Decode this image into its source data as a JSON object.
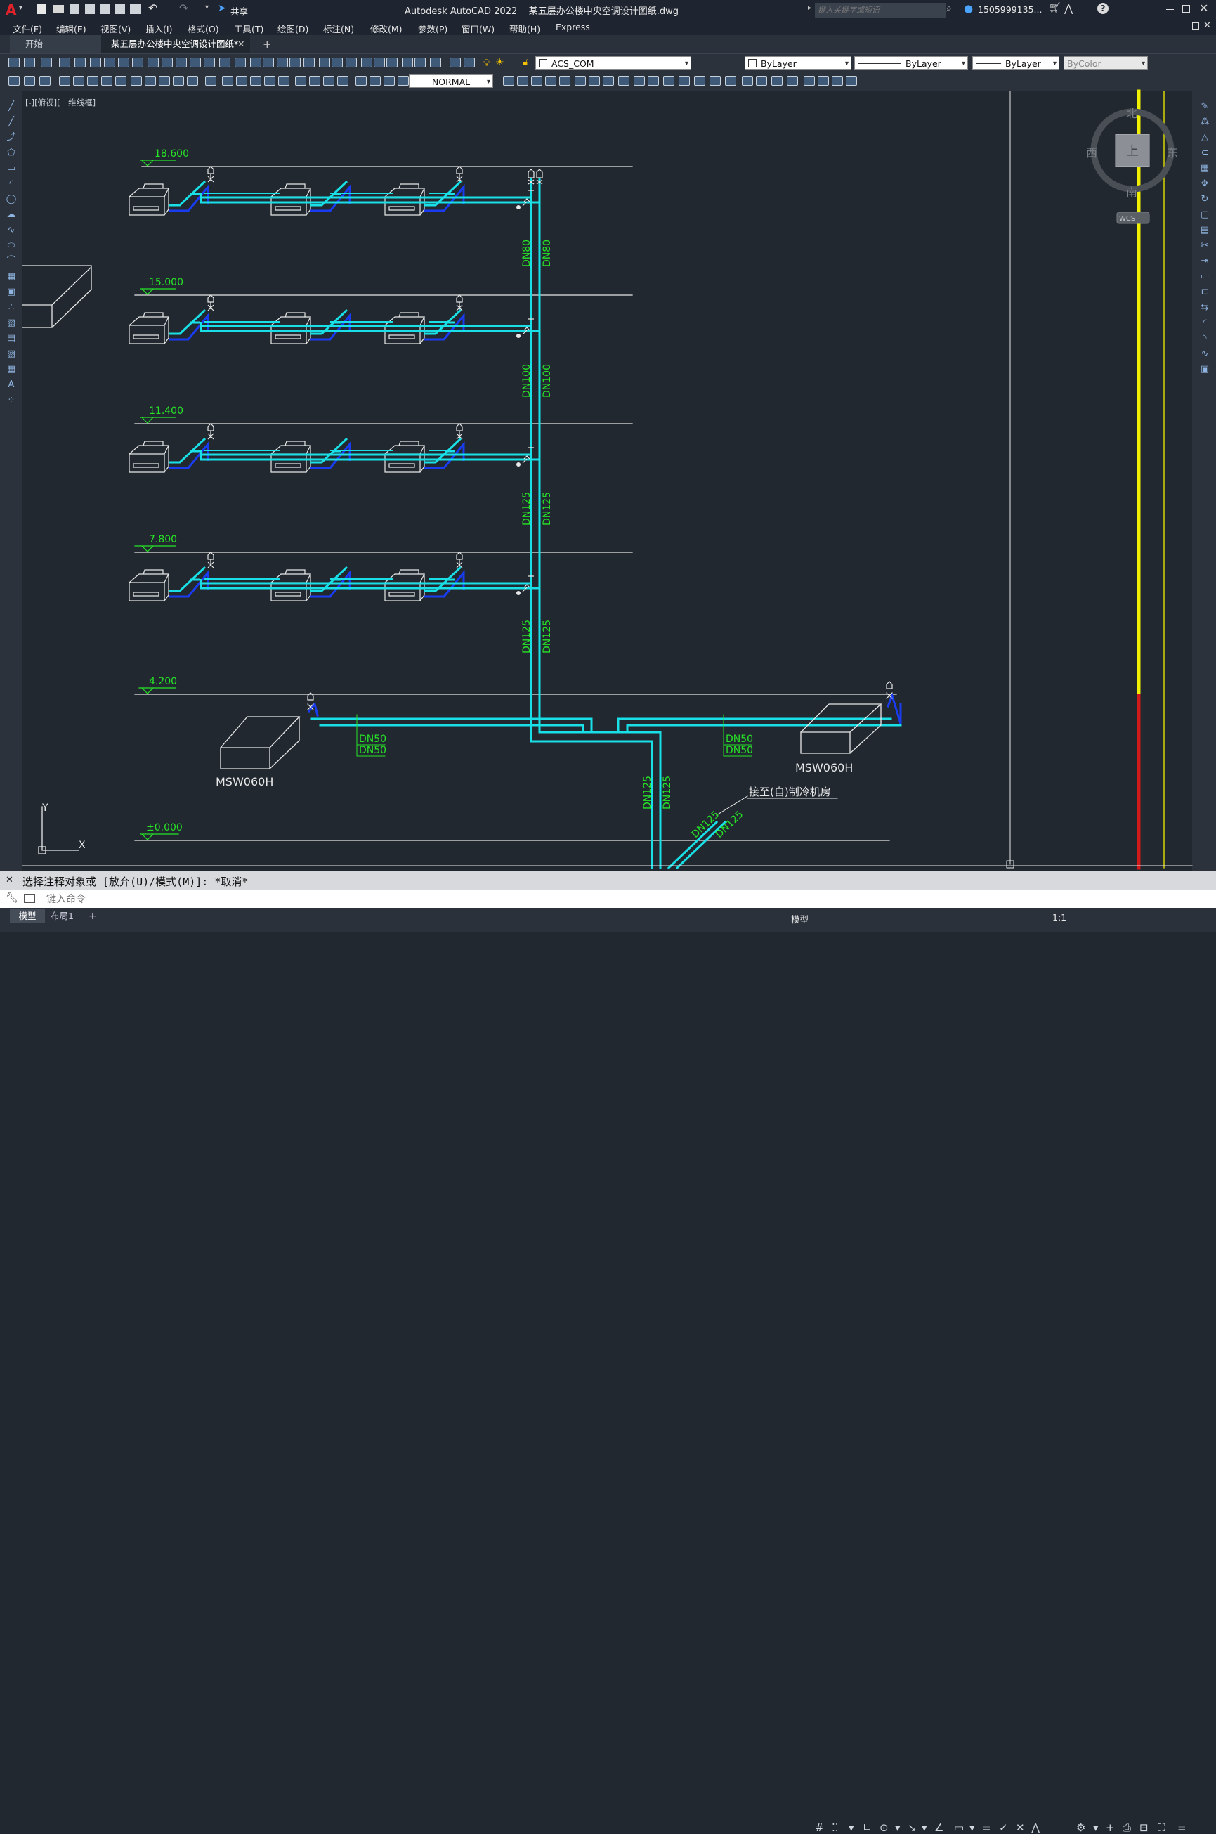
{
  "app": {
    "title": "Autodesk AutoCAD 2022    某五层办公楼中央空调设计图纸.dwg",
    "share_label": "共享",
    "search_placeholder": "键入关键字或短语",
    "user": "1505999135...",
    "help": "?"
  },
  "menu": [
    "文件(F)",
    "编辑(E)",
    "视图(V)",
    "插入(I)",
    "格式(O)",
    "工具(T)",
    "绘图(D)",
    "标注(N)",
    "修改(M)",
    "参数(P)",
    "窗口(W)",
    "帮助(H)",
    "Express"
  ],
  "tabs": {
    "start": "开始",
    "doc": "某五层办公楼中央空调设计图纸*",
    "add": "+"
  },
  "toolbar": {
    "layer": "ACS_COM",
    "color": "ByLayer",
    "linetype": "ByLayer",
    "lineweight": "ByLayer",
    "plotstyle": "ByColor",
    "dimstyle": "NORMAL"
  },
  "viewport_label": "[-][俯视][二维线框]",
  "viewcube": {
    "north": "北",
    "south": "南",
    "east": "东",
    "west": "西",
    "top": "上",
    "wcs": "WCS"
  },
  "drawing": {
    "levels": [
      "18.600",
      "15.000",
      "11.400",
      "7.800",
      "4.200",
      "±0.000"
    ],
    "riser_labels_left": [
      "DN80",
      "DN100",
      "DN125",
      "DN125"
    ],
    "riser_labels_right": [
      "DN80",
      "DN100",
      "DN125",
      "DN125"
    ],
    "branch_labels": [
      "DN50",
      "DN50"
    ],
    "main_labels": [
      "DN125",
      "DN125"
    ],
    "diag_labels": [
      "DN125",
      "DN125"
    ],
    "unit_label": "MSW060H",
    "note": "接至(自)制冷机房",
    "axis_y": "Y",
    "axis_x": "X"
  },
  "colors": {
    "cyan": "#19dfe6",
    "blue": "#1a3cf0",
    "green": "#27e427",
    "white": "#e8e8e8",
    "yellow": "#f0f000",
    "red": "#d21a1a",
    "bg": "#212830"
  },
  "command": {
    "history": "选择注释对象或 [放弃(U)/模式(M)]: *取消*",
    "placeholder": "键入命令"
  },
  "status": {
    "model_tab": "模型",
    "layout_tab": "布局1",
    "add": "+",
    "model_btn": "模型",
    "scale": "1:1"
  }
}
